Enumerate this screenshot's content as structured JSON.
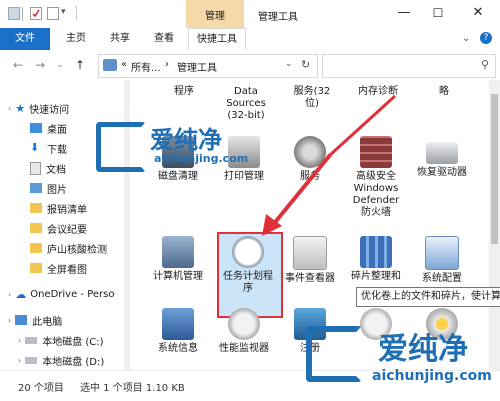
{
  "window": {
    "title": "管理工具",
    "context_tab": "管理",
    "controls": {
      "minimize": "—",
      "maximize": "☐",
      "close": "✕"
    }
  },
  "ribbon": {
    "tabs": [
      "文件",
      "主页",
      "共享",
      "查看",
      "快捷工具"
    ]
  },
  "address": {
    "prefix": "«",
    "crumb1": "所有...",
    "sep1": "›",
    "crumb2": "管理工具",
    "refresh": "↻"
  },
  "nav": {
    "quick_access": "快速访问",
    "items": [
      {
        "label": "桌面",
        "pinned": true
      },
      {
        "label": "下载",
        "pinned": true
      },
      {
        "label": "文档",
        "pinned": true
      },
      {
        "label": "图片",
        "pinned": true
      },
      {
        "label": "报销清单",
        "pinned": false
      },
      {
        "label": "会议纪要",
        "pinned": false
      },
      {
        "label": "庐山核酸检测",
        "pinned": false
      },
      {
        "label": "全屏看图",
        "pinned": false
      }
    ],
    "onedrive": "OneDrive - Perso",
    "this_pc": "此电脑",
    "drives": [
      "本地磁盘 (C:)",
      "本地磁盘 (D:)",
      "网络"
    ]
  },
  "content": {
    "top_row_labels": [
      {
        "text": "程序"
      },
      {
        "text": "Data\nSources\n(32-bit)"
      },
      {
        "text": "服务(32\n位)"
      },
      {
        "text": "内存诊断"
      },
      {
        "text": "略"
      }
    ],
    "row1": [
      {
        "label": "磁盘清理",
        "icon": "disk-cleanup-icon"
      },
      {
        "label": "打印管理",
        "icon": "print-management-icon"
      },
      {
        "label": "服务",
        "icon": "services-icon"
      },
      {
        "label": "高级安全\nWindows\nDefender\n防火墙",
        "icon": "firewall-icon"
      },
      {
        "label": "恢复驱动器",
        "icon": "recovery-drive-icon"
      }
    ],
    "row2": [
      {
        "label": "计算机管理",
        "icon": "computer-management-icon"
      },
      {
        "label": "任务计划程\n序",
        "icon": "task-scheduler-icon",
        "selected": true
      },
      {
        "label": "事件查看器",
        "icon": "event-viewer-icon"
      },
      {
        "label": "碎片整理和",
        "icon": "defrag-icon"
      },
      {
        "label": "系统配置",
        "icon": "system-config-icon"
      }
    ],
    "row3": [
      {
        "label": "系统信息",
        "icon": "system-info-icon"
      },
      {
        "label": "性能监视器",
        "icon": "performance-monitor-icon"
      },
      {
        "label": "注册",
        "icon": "registry-icon"
      },
      {
        "label": "",
        "icon": "resource-monitor-icon"
      },
      {
        "label": "",
        "icon": "windows-memory-icon"
      }
    ]
  },
  "tooltip": "优化卷上的文件和碎片，使计算",
  "status": {
    "count": "20 个项目",
    "selection": "选中 1 个项目  1.10 KB"
  },
  "watermark": {
    "brand": "爱纯净",
    "url": "aichunjing.com"
  },
  "colors": {
    "accent": "#1a6fc9",
    "context_tab": "#f6d9a8",
    "highlight_border": "#e0303a",
    "selection_fill": "#cce4f7",
    "arrow": "#e0303a"
  }
}
